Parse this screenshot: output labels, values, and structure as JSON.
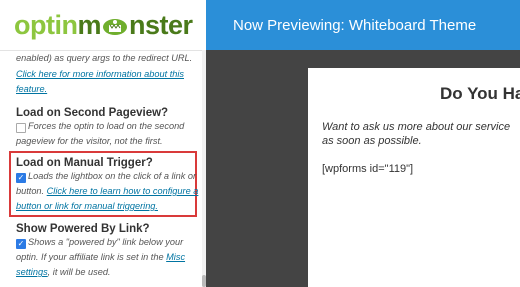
{
  "sidebar": {
    "logo_part1": "optin",
    "logo_part2": "nster",
    "redirect": {
      "desc": "enabled) as query args to the redirect URL.",
      "link1": "Click here for more information about this",
      "link2": "feature."
    },
    "second_pageview": {
      "label": "Load on Second Pageview?",
      "desc1": "Forces the optin to load on the second",
      "desc2": "pageview for the visitor, not the first."
    },
    "manual_trigger": {
      "label": "Load on Manual Trigger?",
      "desc1": "Loads the lightbox on the click of a link or",
      "desc2_prefix": "button.",
      "link1": "Click here to learn how to configure a",
      "link2": "button or link for manual triggering."
    },
    "powered_by": {
      "label": "Show Powered By Link?",
      "desc1": "Shows a \"powered by\" link below your",
      "desc2_prefix": "optin. If your affiliate link is set in the",
      "link_misc": "Misc",
      "link_settings": "settings",
      "desc3_suffix": ", it will be used."
    }
  },
  "header": {
    "title": "Now Previewing: Whiteboard Theme"
  },
  "preview": {
    "heading": "Do You Ha",
    "body1": "Want to ask us more about our service",
    "body2": "as soon as possible.",
    "shortcode": "[wpforms id=\"119\"]"
  },
  "colors": {
    "topbar": "#2b8fd8",
    "accent_link": "#0074a2",
    "highlight_box": "#d93a3a",
    "logo_light": "#8dc63f",
    "logo_dark": "#4a7a1a"
  }
}
